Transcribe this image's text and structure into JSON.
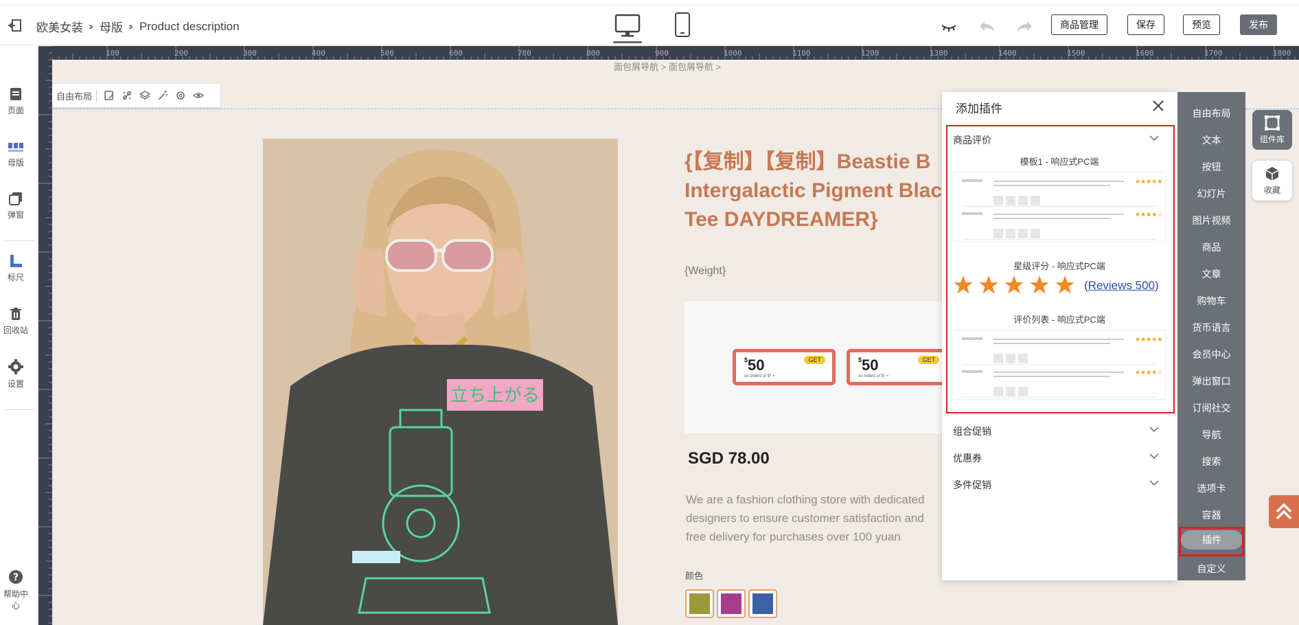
{
  "topbar": {
    "breadcrumb": [
      "欧美女装",
      "母版",
      "Product description"
    ],
    "buttons": {
      "products": "商品管理",
      "save": "保存",
      "preview": "预览",
      "publish": "发布"
    }
  },
  "leftnav": {
    "items": [
      "页面",
      "母版",
      "弹窗",
      "标尺",
      "回收站",
      "设置"
    ],
    "help": "帮助中心"
  },
  "ruler": {
    "top": [
      "100",
      "200",
      "300",
      "400",
      "500",
      "600",
      "700",
      "800",
      "900",
      "1000",
      "1100",
      "1200",
      "1300",
      "1400",
      "1500",
      "1600",
      "1700",
      "1800"
    ]
  },
  "canvas": {
    "breadcrumb_text": "面包屑导航 > 面包屑导航 >",
    "layout_toolbar_label": "自由布局"
  },
  "product": {
    "title": "{【复制】【复制】Beastie B\nIntergalactic Pigment Blac\nTee DAYDREAMER}",
    "weight": "{Weight}",
    "price": "SGD 78.00",
    "description": "We are a fashion clothing store with dedicated designers to ensure customer satisfaction and free delivery for purchases over 100 yuan",
    "color_label": "颜色",
    "coupon_amount": "50",
    "coupon_currency": "$",
    "coupon_get": "GET",
    "coupon_note": "on orders of $* +",
    "swatches": [
      "#9a9a3a",
      "#a63c8c",
      "#3a63a6"
    ]
  },
  "plugin_panel": {
    "title": "添加插件",
    "sections": [
      {
        "name": "商品评价"
      },
      {
        "name": "组合促销"
      },
      {
        "name": "优惠券"
      },
      {
        "name": "多件促销"
      }
    ],
    "templates": [
      "模板1 - 响应式PC端",
      "星级评分 - 响应式PC端",
      "评价列表 - 响应式PC端"
    ],
    "reviews_text": "Reviews 500",
    "star_color": "#f08a24"
  },
  "rail": {
    "items": [
      "自由布局",
      "文本",
      "按钮",
      "幻灯片",
      "图片视频",
      "商品",
      "文章",
      "购物车",
      "货币语言",
      "会员中心",
      "弹出窗口",
      "订阅社交",
      "导航",
      "搜索",
      "选项卡",
      "容器",
      "插件",
      "自定义"
    ],
    "active": "插件"
  },
  "side_buttons": {
    "library": "组件库",
    "favorites": "收藏"
  },
  "colors": {
    "accent": "#c77852",
    "rail_bg": "#6b6f76",
    "highlight": "#d9221d"
  }
}
